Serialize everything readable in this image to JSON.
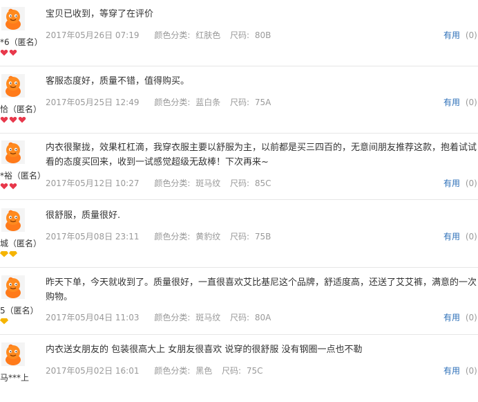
{
  "reviews": [
    {
      "username": "*6（匿名）",
      "content": "宝贝已收到，等穿了在评价",
      "date": "2017年05月26日 07:19",
      "color_label": "颜色分类:",
      "color": "红肤色",
      "size_label": "尺码:",
      "size": "80B",
      "useful_label": "有用",
      "useful_count": "(0)",
      "badge_type": "heart",
      "badge_count": 2
    },
    {
      "username": "恰（匿名）",
      "content": "客服态度好，质量不错，值得购买。",
      "date": "2017年05月25日 12:49",
      "color_label": "颜色分类:",
      "color": "蓝白条",
      "size_label": "尺码:",
      "size": "75A",
      "useful_label": "有用",
      "useful_count": "(0)",
      "badge_type": "heart",
      "badge_count": 3
    },
    {
      "username": "*裕（匿名）",
      "content": "内衣很聚拢，效果杠杠滴，我穿衣服主要以舒服为主，以前都是买三四百的，无意间朋友推荐这款，抱着试试看的态度买回来，收到一试感觉超级无敌棒！下次再来~",
      "date": "2017年05月12日 10:27",
      "color_label": "颜色分类:",
      "color": "斑马纹",
      "size_label": "尺码:",
      "size": "85C",
      "useful_label": "有用",
      "useful_count": "(0)",
      "badge_type": "heart",
      "badge_count": 2
    },
    {
      "username": "城（匿名）",
      "content": "很舒服，质量很好.",
      "date": "2017年05月08日 23:11",
      "color_label": "颜色分类:",
      "color": "黄豹纹",
      "size_label": "尺码:",
      "size": "75B",
      "useful_label": "有用",
      "useful_count": "(0)",
      "badge_type": "diamond",
      "badge_count": 2
    },
    {
      "username": "5（匿名）",
      "content": "昨天下单，今天就收到了。质量很好，一直很喜欢艾比基尼这个品牌，舒适度高，还送了艾艾裤，满意的一次购物。",
      "date": "2017年05月04日 11:03",
      "color_label": "颜色分类:",
      "color": "斑马纹",
      "size_label": "尺码:",
      "size": "80A",
      "useful_label": "有用",
      "useful_count": "(0)",
      "badge_type": "diamond",
      "badge_count": 1
    },
    {
      "username": "马***上",
      "content": "内衣送女朋友的 包装很高大上 女朋友很喜欢 说穿的很舒服 没有钢圈一点也不勒",
      "date": "2017年05月02日 16:01",
      "color_label": "颜色分类:",
      "color": "黑色",
      "size_label": "尺码:",
      "size": "75C",
      "useful_label": "有用",
      "useful_count": "(0)",
      "badge_type": "none",
      "badge_count": 0
    }
  ],
  "colors": {
    "heart": "#e8384b",
    "diamond": "#f5b400",
    "link": "#2c6fb8",
    "meta": "#999999",
    "avatar": "#ff7a1a"
  }
}
